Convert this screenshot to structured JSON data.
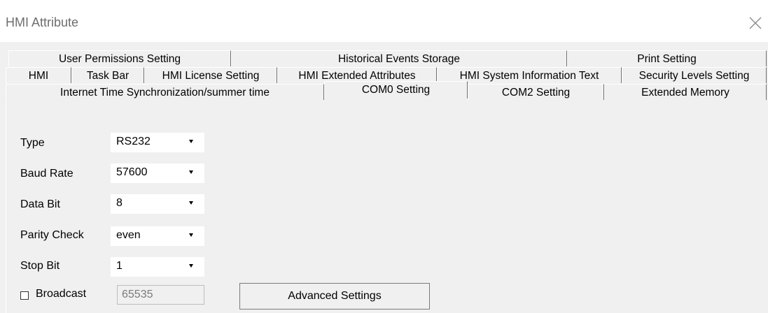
{
  "window": {
    "title": "HMI Attribute",
    "close_icon": "close-icon"
  },
  "tabs": {
    "row1": [
      {
        "label": "User Permissions Setting"
      },
      {
        "label": "Historical Events Storage"
      },
      {
        "label": "Print Setting"
      }
    ],
    "row2": [
      {
        "label": "HMI"
      },
      {
        "label": "Task Bar"
      },
      {
        "label": "HMI License Setting"
      },
      {
        "label": "HMI Extended Attributes"
      },
      {
        "label": "HMI System Information Text"
      },
      {
        "label": "Security Levels Setting"
      }
    ],
    "row3": [
      {
        "label": "Internet Time Synchronization/summer time"
      },
      {
        "label": "COM0 Setting",
        "active": true
      },
      {
        "label": "COM2 Setting"
      },
      {
        "label": "Extended Memory"
      }
    ]
  },
  "com0": {
    "type": {
      "label": "Type",
      "value": "RS232"
    },
    "baud_rate": {
      "label": "Baud Rate",
      "value": "57600"
    },
    "data_bit": {
      "label": "Data Bit",
      "value": "8"
    },
    "parity_check": {
      "label": "Parity Check",
      "value": "even"
    },
    "stop_bit": {
      "label": "Stop Bit",
      "value": "1"
    },
    "broadcast": {
      "label": "Broadcast",
      "value": "65535",
      "checked": false
    },
    "advanced_button": "Advanced Settings"
  }
}
